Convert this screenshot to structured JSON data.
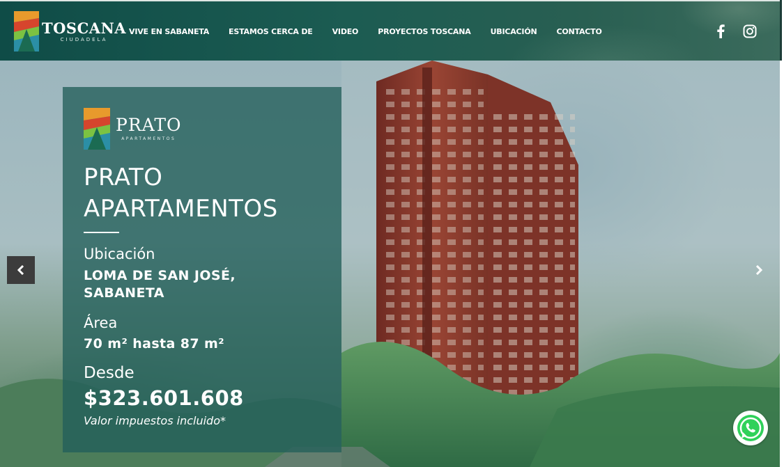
{
  "header": {
    "logo": {
      "title": "TOSCANA",
      "subtitle": "CIUDADELA"
    },
    "nav": [
      {
        "label": "VIVE EN SABANETA"
      },
      {
        "label": "ESTAMOS CERCA DE"
      },
      {
        "label": "VIDEO"
      },
      {
        "label": "PROYECTOS TOSCANA"
      },
      {
        "label": "UBICACIÓN"
      },
      {
        "label": "CONTACTO"
      }
    ],
    "social": [
      {
        "icon": "facebook-icon"
      },
      {
        "icon": "instagram-icon"
      }
    ]
  },
  "hero": {
    "project_logo": {
      "title": "PRATO",
      "subtitle": "APARTAMENTOS"
    },
    "title": "PRATO APARTAMENTOS",
    "location_label": "Ubicación",
    "location_value": "LOMA DE SAN JOSÉ, SABANETA",
    "area_label": "Área",
    "area_value": "70 m² hasta 87 m²",
    "price_label": "Desde",
    "price_value": "$323.601.608",
    "price_note": "Valor impuestos incluido*"
  },
  "colors": {
    "header_bg": "#1c5c52",
    "panel_bg": "#235f5a",
    "building": "#8a3a2e",
    "whatsapp": "#2fd15a"
  },
  "icons": {
    "prev": "chevron-left-icon",
    "next": "chevron-right-icon",
    "chat": "whatsapp-icon"
  }
}
